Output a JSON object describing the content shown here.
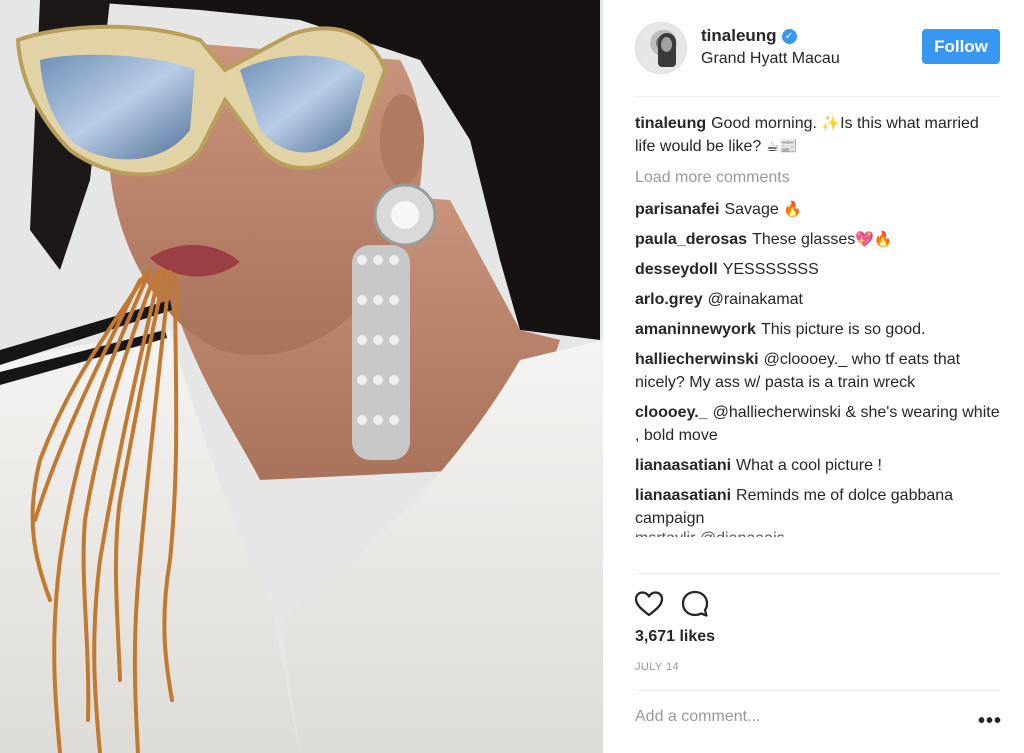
{
  "post": {
    "image_description_label": "photo"
  },
  "header": {
    "username": "tinaleung",
    "location": "Grand Hyatt Macau",
    "follow_label": "Follow"
  },
  "caption": {
    "user": "tinaleung",
    "text_part1": "Good morning. ",
    "emoji1": "✨",
    "text_part2": "Is this what married life would be like? ",
    "emoji2": "☕📰"
  },
  "load_more": "Load more comments",
  "comments": [
    {
      "user": "parisanafei",
      "text": "Savage ",
      "emoji": "🔥"
    },
    {
      "user": "paula_derosas",
      "text": "These glasses",
      "emoji": "💖🔥"
    },
    {
      "user": "desseydoll",
      "text": "YESSSSSSS",
      "emoji": ""
    },
    {
      "user": "arlo.grey",
      "text": "@rainakamat",
      "emoji": ""
    },
    {
      "user": "amaninnewyork",
      "text": "This picture is so good.",
      "emoji": ""
    },
    {
      "user": "halliecherwinski",
      "text": "@cloooey._ who tf eats that nicely? My ass w/ pasta is a train wreck",
      "emoji": ""
    },
    {
      "user": "cloooey._",
      "text": "@halliecherwinski & she's wearing white , bold move",
      "emoji": ""
    },
    {
      "user": "lianaasatiani",
      "text": "What a cool picture !",
      "emoji": ""
    },
    {
      "user": "lianaasatiani",
      "text": "Reminds me of dolce gabbana campaign",
      "emoji": ""
    }
  ],
  "partial_comment": "msrtaylir @dianaaais",
  "likes": "3,671 likes",
  "date": "JULY 14",
  "add_comment_placeholder": "Add a comment...",
  "icons": {
    "like": "heart-outline-icon",
    "comment": "speech-bubble-icon",
    "more": "ellipsis-icon",
    "verified": "verified-badge-icon"
  },
  "colors": {
    "accent": "#3897f0",
    "muted": "#999999",
    "divider": "#efefef"
  }
}
